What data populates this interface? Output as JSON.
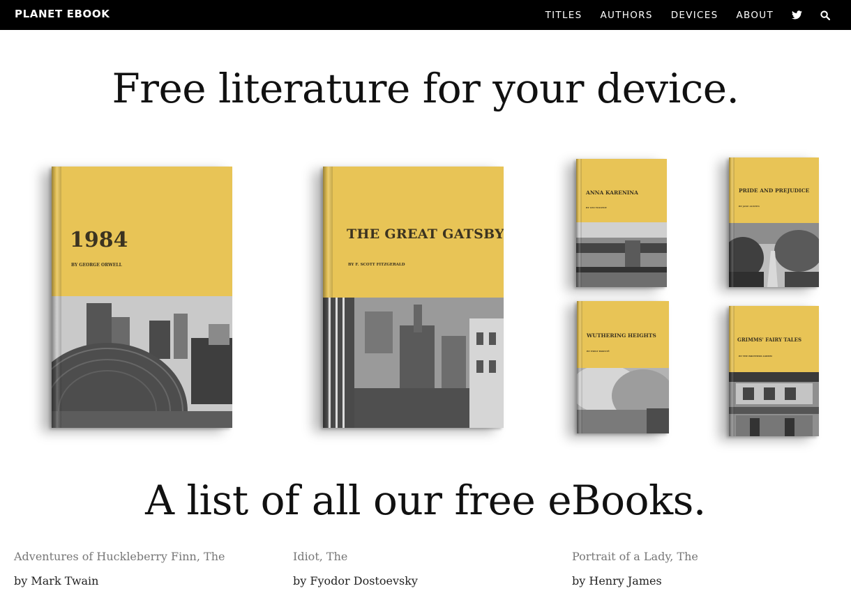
{
  "nav": {
    "brand": "PLANET EBOOK",
    "links": [
      "TITLES",
      "AUTHORS",
      "DEVICES",
      "ABOUT"
    ],
    "icons": [
      "twitter-icon",
      "search-icon"
    ]
  },
  "hero": {
    "heading": "Free literature for your device."
  },
  "books": [
    {
      "title": "1984",
      "author": "By George Orwell"
    },
    {
      "title": "The Great Gatsby",
      "author": "By F. Scott Fitzgerald"
    },
    {
      "title": "Anna Karenina",
      "author": "By Leo Tolstoy"
    },
    {
      "title": "Pride and Prejudice",
      "author": "By Jane Austen"
    },
    {
      "title": "Wuthering Heights",
      "author": "By Emily Brontë"
    },
    {
      "title": "Grimms' Fairy Tales",
      "author": "By The Brothers Grimm"
    }
  ],
  "list": {
    "heading": "A list of all our free eBooks.",
    "entries": [
      {
        "title": "Adventures of Huckleberry Finn, The",
        "author": "by Mark Twain"
      },
      {
        "title": "Idiot, The",
        "author": "by Fyodor Dostoevsky"
      },
      {
        "title": "Portrait of a Lady, The",
        "author": "by Henry James"
      }
    ]
  },
  "colors": {
    "cover_yellow": "#e8c456",
    "nav_bg": "#000000"
  }
}
